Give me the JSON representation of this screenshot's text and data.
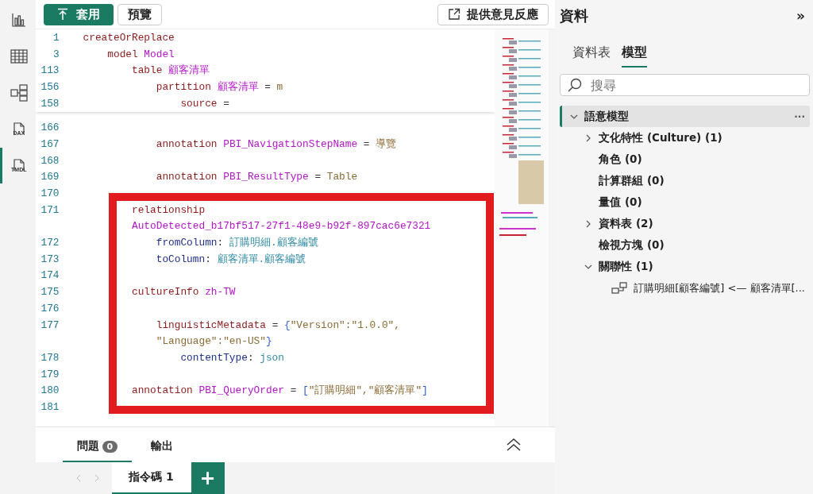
{
  "rail": [
    {
      "kind": "report",
      "selected": false
    },
    {
      "kind": "table",
      "selected": false
    },
    {
      "kind": "model",
      "selected": false
    },
    {
      "kind": "dax",
      "label": "DAX",
      "selected": false
    },
    {
      "kind": "tmdl",
      "label": "TMDL",
      "selected": true
    }
  ],
  "toolbar": {
    "apply": "套用",
    "preview": "預覽",
    "feedback": "提供意見反應"
  },
  "sticky_lines": [
    {
      "number": "1",
      "rows": [
        [
          {
            "text": "createOrReplace",
            "kind": "kw"
          }
        ]
      ]
    },
    {
      "number": "3",
      "rows": [
        [
          {
            "text": "    model ",
            "kind": "kw"
          },
          {
            "text": "Model",
            "kind": "name"
          }
        ]
      ]
    },
    {
      "number": "113",
      "rows": [
        [
          {
            "text": "        table ",
            "kind": "kw"
          },
          {
            "text": "顧客清單",
            "kind": "name"
          }
        ]
      ]
    },
    {
      "number": "156",
      "rows": [
        [
          {
            "text": "            partition ",
            "kind": "kw"
          },
          {
            "text": "顧客清單",
            "kind": "name"
          },
          {
            "text": " = ",
            "kind": "op"
          },
          {
            "text": "m",
            "kind": "str"
          }
        ]
      ]
    },
    {
      "number": "158",
      "rows": [
        [
          {
            "text": "                source ",
            "kind": "kw"
          },
          {
            "text": "=",
            "kind": "op"
          }
        ]
      ]
    }
  ],
  "lines": [
    {
      "number": "166"
    },
    {
      "number": "167",
      "rows": [
        [
          {
            "text": "            annotation ",
            "kind": "kw"
          },
          {
            "text": "PBI_NavigationStepName",
            "kind": "name"
          },
          {
            "text": " = ",
            "kind": "op"
          },
          {
            "text": "導覽",
            "kind": "str"
          }
        ]
      ]
    },
    {
      "number": "168"
    },
    {
      "number": "169",
      "rows": [
        [
          {
            "text": "            annotation ",
            "kind": "kw"
          },
          {
            "text": "PBI_ResultType",
            "kind": "name"
          },
          {
            "text": " = ",
            "kind": "op"
          },
          {
            "text": "Table",
            "kind": "str"
          }
        ]
      ]
    },
    {
      "number": "170"
    },
    {
      "number": "171",
      "rows": [
        [
          {
            "text": "        relationship",
            "kind": "kw"
          }
        ],
        [
          {
            "text": "        AutoDetected_b17bf517-27f1-48e9-b92f-897cac6e7321",
            "kind": "name"
          }
        ]
      ]
    },
    {
      "number": "172",
      "rows": [
        [
          {
            "text": "            fromColumn",
            "kind": "prop"
          },
          {
            "text": ": ",
            "kind": "op"
          },
          {
            "text": "訂購明細.顧客編號",
            "kind": "value"
          }
        ]
      ]
    },
    {
      "number": "173",
      "rows": [
        [
          {
            "text": "            toColumn",
            "kind": "prop"
          },
          {
            "text": ": ",
            "kind": "op"
          },
          {
            "text": "顧客清單.顧客編號",
            "kind": "value"
          }
        ]
      ]
    },
    {
      "number": "174"
    },
    {
      "number": "175",
      "rows": [
        [
          {
            "text": "        cultureInfo ",
            "kind": "kw"
          },
          {
            "text": "zh-TW",
            "kind": "name"
          }
        ]
      ]
    },
    {
      "number": "176"
    },
    {
      "number": "177",
      "rows": [
        [
          {
            "text": "            linguisticMetadata",
            "kind": "kw"
          },
          {
            "text": " = ",
            "kind": "op"
          },
          {
            "text": "{",
            "kind": "brace"
          },
          {
            "text": "\"Version\":\"1.0.0\",",
            "kind": "str"
          }
        ],
        [
          {
            "text": "            \"Language\":\"en-US\"",
            "kind": "str"
          },
          {
            "text": "}",
            "kind": "brace"
          }
        ]
      ]
    },
    {
      "number": "178",
      "rows": [
        [
          {
            "text": "                contentType",
            "kind": "prop"
          },
          {
            "text": ": ",
            "kind": "op"
          },
          {
            "text": "json",
            "kind": "value"
          }
        ]
      ]
    },
    {
      "number": "179"
    },
    {
      "number": "180",
      "rows": [
        [
          {
            "text": "        annotation ",
            "kind": "kw"
          },
          {
            "text": "PBI_QueryOrder",
            "kind": "name"
          },
          {
            "text": " = ",
            "kind": "op"
          },
          {
            "text": "[",
            "kind": "brace"
          },
          {
            "text": "\"訂購明細\",\"顧客清單\"",
            "kind": "str"
          },
          {
            "text": "]",
            "kind": "brace"
          }
        ]
      ]
    },
    {
      "number": "181"
    }
  ],
  "bottom_tabs": [
    {
      "label": "問題",
      "badge": "0",
      "selected": true
    },
    {
      "label": "輸出",
      "selected": false
    }
  ],
  "script_tabs": [
    {
      "label": "指令碼 1",
      "selected": true
    }
  ],
  "add_tab": "+",
  "data_pane": {
    "title": "資料",
    "collapse": "»",
    "tabs": [
      {
        "label": "資料表",
        "selected": false
      },
      {
        "label": "模型",
        "selected": true
      }
    ],
    "search": {
      "placeholder": "搜尋"
    },
    "tree": [
      {
        "kind": "group",
        "label": "語意模型",
        "expanded": true,
        "selected": true,
        "more": "···",
        "children": [
          {
            "kind": "group",
            "label": "文化特性 (Culture) (1)",
            "expanded": false,
            "selected": false
          },
          {
            "kind": "leaf",
            "label": "角色 (0)",
            "selected": false
          },
          {
            "kind": "leaf",
            "label": "計算群組 (0)",
            "selected": false
          },
          {
            "kind": "leaf",
            "label": "量值 (0)",
            "selected": false
          },
          {
            "kind": "group",
            "label": "資料表 (2)",
            "expanded": false,
            "selected": false
          },
          {
            "kind": "leaf",
            "label": "檢視方塊 (0)",
            "selected": false
          },
          {
            "kind": "group",
            "label": "關聯性 (1)",
            "expanded": true,
            "selected": false,
            "children": [
              {
                "kind": "relationship",
                "label": "訂購明細[顧客編號] <— 顧客清單[...",
                "selected": false
              }
            ]
          }
        ]
      }
    ]
  }
}
